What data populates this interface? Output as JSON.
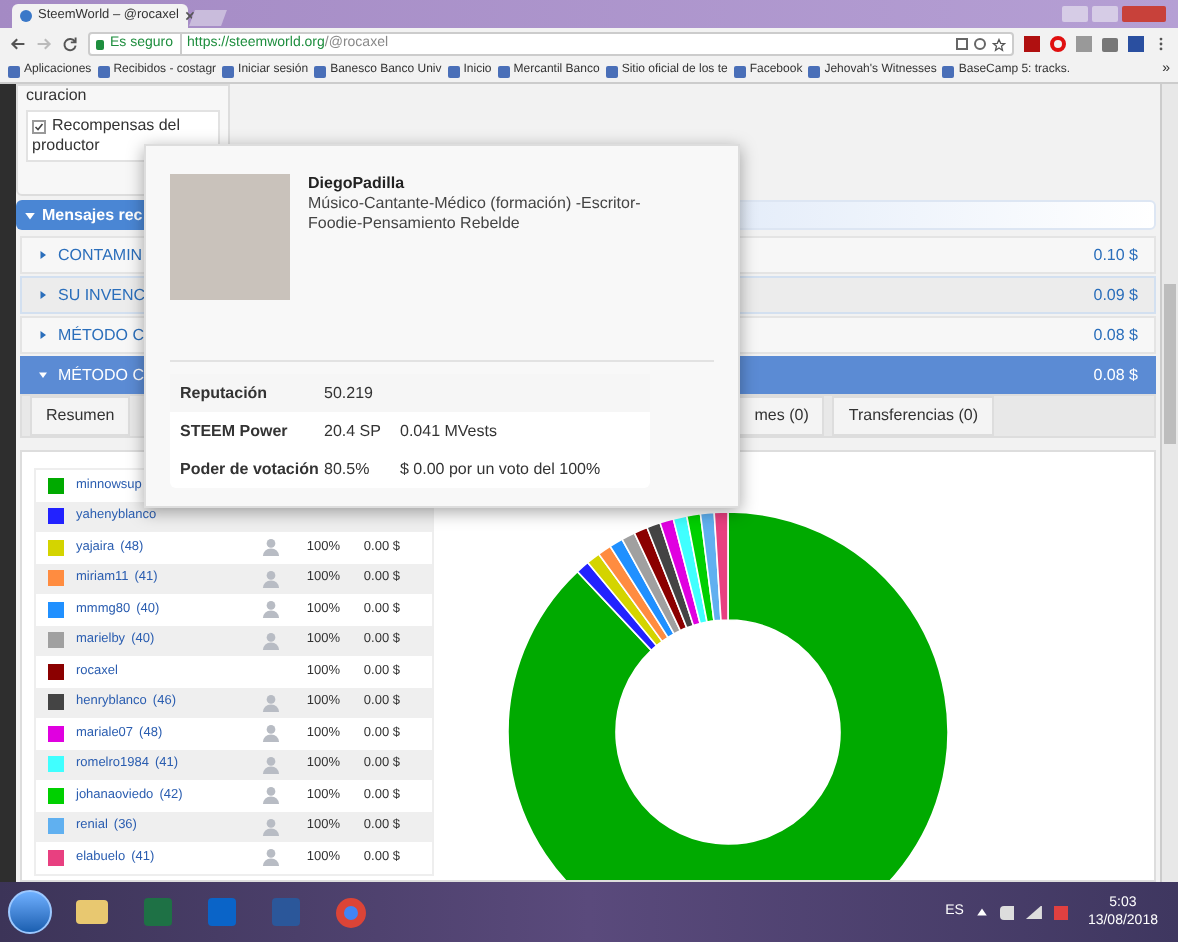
{
  "browser": {
    "tab_title": "SteemWorld – @rocaxel",
    "security_label": "Es seguro",
    "url_host": "https://steemworld.org",
    "url_path": "/@rocaxel",
    "bookmarks": [
      "Aplicaciones",
      "Recibidos - costagr",
      "Iniciar sesión",
      "Banesco Banco Univ",
      "Inicio",
      "Mercantil Banco",
      "Sitio oficial de los te",
      "Facebook",
      "Jehovah's Witnesses",
      "BaseCamp 5: tracks."
    ],
    "more": "»"
  },
  "settings_card": {
    "partial_text": "curacion",
    "checkbox": {
      "label": "Recompensas del productor",
      "checked": true
    }
  },
  "messages_header": "Mensajes rec",
  "message_rows": [
    {
      "title": "CONTAMIN",
      "amount": "0.10 $",
      "expanded": false
    },
    {
      "title": "SU INVENC",
      "amount": "0.09 $",
      "expanded": false
    },
    {
      "title": "MÉTODO C",
      "amount": "0.08 $",
      "expanded": false
    },
    {
      "title": "MÉTODO C",
      "amount": "0.08 $",
      "expanded": true
    }
  ],
  "detail_tabs": [
    "Resumen",
    "mes (0)",
    "Transferencias (0)"
  ],
  "voters": [
    {
      "name": "minnowsup",
      "color": "#00aa00"
    },
    {
      "name": "yahenyblanco",
      "color": "#2222ff"
    },
    {
      "name": "yajaira",
      "reputation": "(48)",
      "profile_icon": true,
      "weight": "100%",
      "amount": "0.00 $",
      "color": "#d4d400"
    },
    {
      "name": "miriam11",
      "reputation": "(41)",
      "profile_icon": true,
      "weight": "100%",
      "amount": "0.00 $",
      "color": "#ff8c40"
    },
    {
      "name": "mmmg80",
      "reputation": "(40)",
      "profile_icon": true,
      "weight": "100%",
      "amount": "0.00 $",
      "color": "#2090ff"
    },
    {
      "name": "marielby",
      "reputation": "(40)",
      "profile_icon": true,
      "weight": "100%",
      "amount": "0.00 $",
      "color": "#a0a0a0"
    },
    {
      "name": "rocaxel",
      "profile_icon": false,
      "weight": "100%",
      "amount": "0.00 $",
      "color": "#8b0000"
    },
    {
      "name": "henryblanco",
      "reputation": "(46)",
      "profile_icon": true,
      "weight": "100%",
      "amount": "0.00 $",
      "color": "#444444"
    },
    {
      "name": "mariale07",
      "reputation": "(48)",
      "profile_icon": true,
      "weight": "100%",
      "amount": "0.00 $",
      "color": "#e000e0"
    },
    {
      "name": "romelro1984",
      "reputation": "(41)",
      "profile_icon": true,
      "weight": "100%",
      "amount": "0.00 $",
      "color": "#40ffff"
    },
    {
      "name": "johanaoviedo",
      "reputation": "(42)",
      "profile_icon": true,
      "weight": "100%",
      "amount": "0.00 $",
      "color": "#00d000"
    },
    {
      "name": "renial",
      "reputation": "(36)",
      "profile_icon": true,
      "weight": "100%",
      "amount": "0.00 $",
      "color": "#60b0f0"
    },
    {
      "name": "elabuelo",
      "reputation": "(41)",
      "profile_icon": true,
      "weight": "100%",
      "amount": "0.00 $",
      "color": "#e84080"
    }
  ],
  "profile_popup": {
    "name": "DiegoPadilla",
    "bio": "Músico-Cantante-Médico (formación) -Escritor-Foodie-Pensamiento Rebelde",
    "stats": [
      {
        "label": "Reputación",
        "value": "50.219"
      },
      {
        "label": "STEEM Power",
        "value": "20.4 SP",
        "extra": "0.041 MVests"
      },
      {
        "label": "Poder de votación",
        "value": "80.5%",
        "extra": "$ 0.00 por un voto del 100%"
      }
    ]
  },
  "taskbar": {
    "language": "ES",
    "time": "5:03",
    "date": "13/08/2018"
  }
}
